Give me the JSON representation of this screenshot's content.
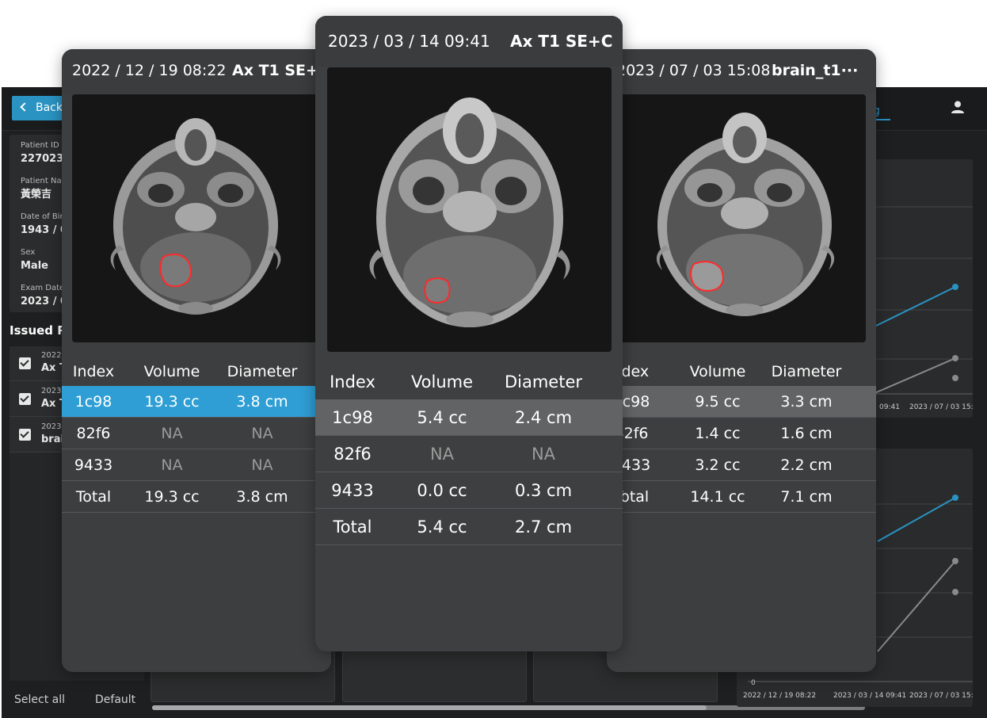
{
  "background_app": {
    "back_label": "Back",
    "tab_fragment": "g",
    "patient": {
      "id_label": "Patient ID",
      "id_value": "2270238",
      "name_label": "Patient Na",
      "name_value": "黃榮吉",
      "dob_label": "Date of Bir",
      "dob_value": "1943 / 0",
      "sex_label": "Sex",
      "sex_value": "Male",
      "exam_label": "Exam Date",
      "exam_value": "2023 / 0"
    },
    "issued_title": "Issued R",
    "issued_items": [
      {
        "date": "2022 ,",
        "name": "Ax T"
      },
      {
        "date": "2023 ,",
        "name": "Ax T"
      },
      {
        "date": "2023 ,",
        "name": "brai"
      }
    ],
    "select_all_label": "Select all",
    "default_label": "Default",
    "chart_top": {
      "x_ticks": [
        "09:41",
        "2023 / 07 / 03 15:08"
      ]
    },
    "chart_bottom": {
      "y_tick_zero": "0",
      "x_ticks": [
        "2022 / 12 / 19 08:22",
        "2023 / 03 / 14 09:41",
        "2023 / 07 / 03 15:08"
      ]
    },
    "colors": {
      "accent": "#2a93c2",
      "highlight": "#2e9ed4",
      "lesion": "#ff2a2a"
    }
  },
  "cards": [
    {
      "date": "2022 / 12 / 19 08:22",
      "sequence": "Ax T1 SE+C",
      "columns": [
        "Index",
        "Volume",
        "Diameter"
      ],
      "rows": [
        {
          "index": "1c98",
          "volume": "19.3 cc",
          "diameter": "3.8 cm"
        },
        {
          "index": "82f6",
          "volume": "NA",
          "diameter": "NA"
        },
        {
          "index": "9433",
          "volume": "NA",
          "diameter": "NA"
        },
        {
          "index": "Total",
          "volume": "19.3 cc",
          "diameter": "3.8 cm"
        }
      ]
    },
    {
      "date": "2023 / 03 / 14 09:41",
      "sequence": "Ax T1 SE+C",
      "columns": [
        "Index",
        "Volume",
        "Diameter"
      ],
      "rows": [
        {
          "index": "1c98",
          "volume": "5.4 cc",
          "diameter": "2.4 cm"
        },
        {
          "index": "82f6",
          "volume": "NA",
          "diameter": "NA"
        },
        {
          "index": "9433",
          "volume": "0.0 cc",
          "diameter": "0.3 cm"
        },
        {
          "index": "Total",
          "volume": "5.4 cc",
          "diameter": "2.7 cm"
        }
      ]
    },
    {
      "date": "2023 / 07 / 03 15:08",
      "sequence": "brain_t1···",
      "columns": [
        "Index",
        "Volume",
        "Diameter"
      ],
      "rows": [
        {
          "index": "1c98",
          "volume": "9.5 cc",
          "diameter": "3.3 cm"
        },
        {
          "index": "82f6",
          "volume": "1.4 cc",
          "diameter": "1.6 cm"
        },
        {
          "index": "9433",
          "volume": "3.2 cc",
          "diameter": "2.2 cm"
        },
        {
          "index": "Total",
          "volume": "14.1 cc",
          "diameter": "7.1 cm"
        }
      ]
    }
  ]
}
